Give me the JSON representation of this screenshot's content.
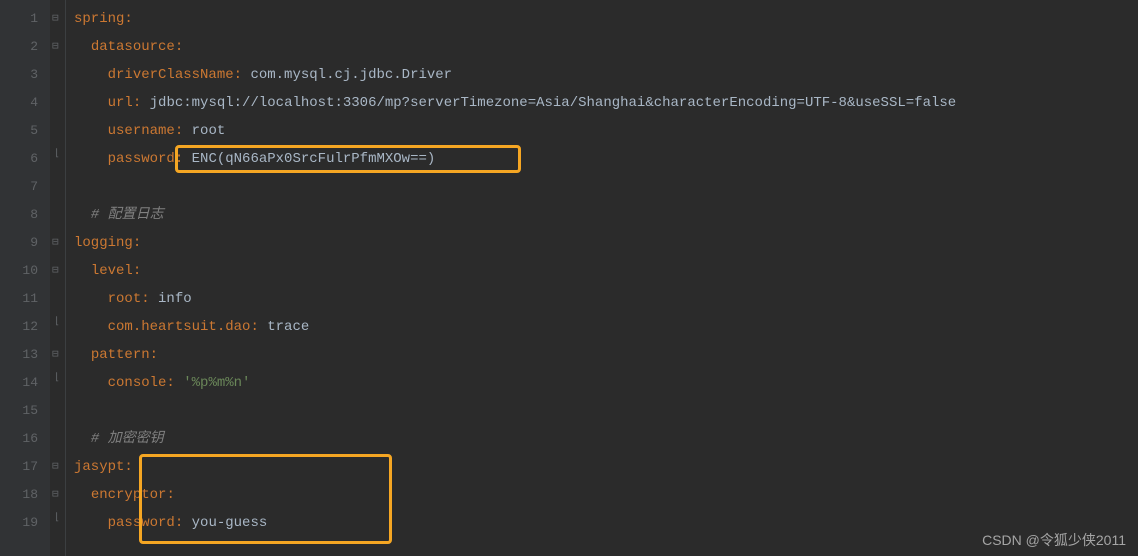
{
  "lines": [
    {
      "num": "1",
      "indent": 0,
      "fold": "open",
      "parts": [
        {
          "t": "spring",
          "c": "key"
        },
        {
          "t": ":",
          "c": "colon"
        }
      ]
    },
    {
      "num": "2",
      "indent": 1,
      "fold": "open",
      "parts": [
        {
          "t": "datasource",
          "c": "key"
        },
        {
          "t": ":",
          "c": "colon"
        }
      ]
    },
    {
      "num": "3",
      "indent": 2,
      "fold": "",
      "parts": [
        {
          "t": "driverClassName",
          "c": "key"
        },
        {
          "t": ": ",
          "c": "colon"
        },
        {
          "t": "com.mysql.cj.jdbc.Driver",
          "c": "value"
        }
      ]
    },
    {
      "num": "4",
      "indent": 2,
      "fold": "",
      "parts": [
        {
          "t": "url",
          "c": "key"
        },
        {
          "t": ": ",
          "c": "colon"
        },
        {
          "t": "jdbc:mysql://localhost:3306/mp?serverTimezone=Asia/Shanghai&characterEncoding=UTF-8&useSSL=false",
          "c": "value"
        }
      ]
    },
    {
      "num": "5",
      "indent": 2,
      "fold": "",
      "parts": [
        {
          "t": "username",
          "c": "key"
        },
        {
          "t": ": ",
          "c": "colon"
        },
        {
          "t": "root",
          "c": "value"
        }
      ]
    },
    {
      "num": "6",
      "indent": 2,
      "fold": "close",
      "parts": [
        {
          "t": "password",
          "c": "key"
        },
        {
          "t": ": ",
          "c": "colon"
        },
        {
          "t": "ENC(qN66aPx0SrcFulrPfmMXOw==)",
          "c": "value"
        }
      ]
    },
    {
      "num": "7",
      "indent": 0,
      "fold": "",
      "parts": []
    },
    {
      "num": "8",
      "indent": 1,
      "fold": "",
      "parts": [
        {
          "t": "# 配置日志",
          "c": "comment"
        }
      ]
    },
    {
      "num": "9",
      "indent": 0,
      "fold": "open",
      "parts": [
        {
          "t": "logging",
          "c": "key"
        },
        {
          "t": ":",
          "c": "colon"
        }
      ]
    },
    {
      "num": "10",
      "indent": 1,
      "fold": "open",
      "parts": [
        {
          "t": "level",
          "c": "key"
        },
        {
          "t": ":",
          "c": "colon"
        }
      ]
    },
    {
      "num": "11",
      "indent": 2,
      "fold": "",
      "parts": [
        {
          "t": "root",
          "c": "key"
        },
        {
          "t": ": ",
          "c": "colon"
        },
        {
          "t": "info",
          "c": "value"
        }
      ]
    },
    {
      "num": "12",
      "indent": 2,
      "fold": "close",
      "parts": [
        {
          "t": "com.heartsuit.dao",
          "c": "key"
        },
        {
          "t": ": ",
          "c": "colon"
        },
        {
          "t": "trace",
          "c": "value"
        }
      ]
    },
    {
      "num": "13",
      "indent": 1,
      "fold": "open",
      "parts": [
        {
          "t": "pattern",
          "c": "key"
        },
        {
          "t": ":",
          "c": "colon"
        }
      ]
    },
    {
      "num": "14",
      "indent": 2,
      "fold": "close",
      "parts": [
        {
          "t": "console",
          "c": "key"
        },
        {
          "t": ": ",
          "c": "colon"
        },
        {
          "t": "'%p%m%n'",
          "c": "string"
        }
      ]
    },
    {
      "num": "15",
      "indent": 0,
      "fold": "",
      "parts": []
    },
    {
      "num": "16",
      "indent": 1,
      "fold": "",
      "parts": [
        {
          "t": "# 加密密钥",
          "c": "comment"
        }
      ]
    },
    {
      "num": "17",
      "indent": 0,
      "fold": "open",
      "parts": [
        {
          "t": "jasypt",
          "c": "key"
        },
        {
          "t": ":",
          "c": "colon"
        }
      ]
    },
    {
      "num": "18",
      "indent": 1,
      "fold": "open",
      "parts": [
        {
          "t": "encryptor",
          "c": "key"
        },
        {
          "t": ":",
          "c": "colon"
        }
      ]
    },
    {
      "num": "19",
      "indent": 2,
      "fold": "close",
      "parts": [
        {
          "t": "password",
          "c": "key"
        },
        {
          "t": ": ",
          "c": "colon"
        },
        {
          "t": "you-guess",
          "c": "value"
        }
      ]
    }
  ],
  "watermark": "CSDN @令狐少侠2011"
}
